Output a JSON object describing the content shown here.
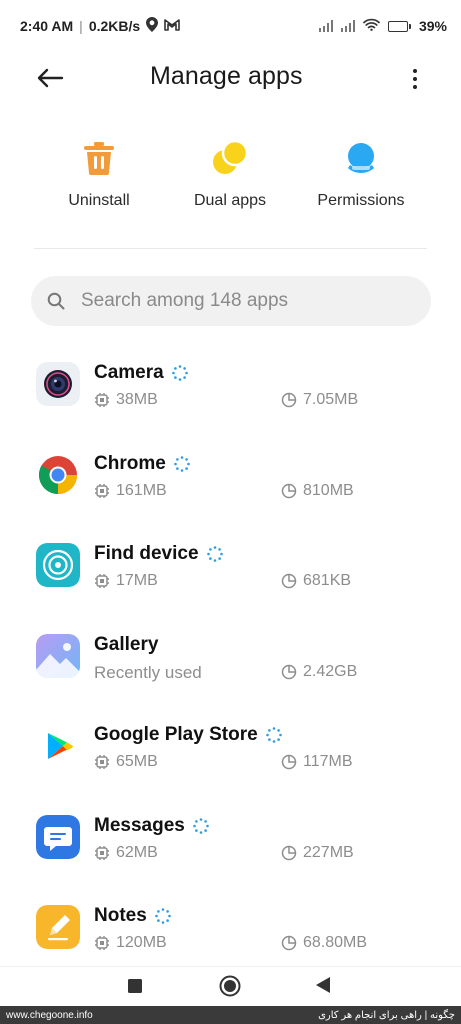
{
  "status_bar": {
    "time": "2:40 AM",
    "separator": "|",
    "speed": "0.2KB/s",
    "battery": "39%",
    "icons": [
      "location-icon",
      "gmail-icon",
      "signal-icon",
      "signal-icon",
      "wifi-icon",
      "battery-charging-icon"
    ]
  },
  "header": {
    "title": "Manage apps",
    "back_icon": "back-arrow-icon",
    "menu_icon": "more-vertical-icon"
  },
  "actions": [
    {
      "label": "Uninstall",
      "icon": "trash-icon",
      "color": "#f29b3a"
    },
    {
      "label": "Dual apps",
      "icon": "dual-circles-icon",
      "color": "#f9d21b"
    },
    {
      "label": "Permissions",
      "icon": "permissions-icon",
      "color": "#2aa8f2"
    }
  ],
  "search": {
    "placeholder": "Search among 148 apps",
    "icon": "search-icon"
  },
  "apps": [
    {
      "name": "Camera",
      "memory": "38MB",
      "storage": "7.05MB",
      "loading": true
    },
    {
      "name": "Chrome",
      "memory": "161MB",
      "storage": "810MB",
      "loading": true
    },
    {
      "name": "Find device",
      "memory": "17MB",
      "storage": "681KB",
      "loading": true
    },
    {
      "name": "Gallery",
      "memory": "Recently used",
      "storage": "2.42GB",
      "loading": false
    },
    {
      "name": "Google Play Store",
      "memory": "65MB",
      "storage": "117MB",
      "loading": true
    },
    {
      "name": "Messages",
      "memory": "62MB",
      "storage": "227MB",
      "loading": true
    },
    {
      "name": "Notes",
      "memory": "120MB",
      "storage": "68.80MB",
      "loading": true
    }
  ],
  "navbar": {
    "icons": [
      "recents-square-icon",
      "home-circle-icon",
      "back-triangle-icon"
    ]
  },
  "watermark": {
    "left": "www.chegoone.info",
    "right": "چگونه | راهی برای انجام هر کاری"
  },
  "colors": {
    "accent_orange": "#f29b3a",
    "accent_yellow": "#f9d21b",
    "accent_blue": "#2aa8f2",
    "spinner_blue": "#2f9be0"
  }
}
